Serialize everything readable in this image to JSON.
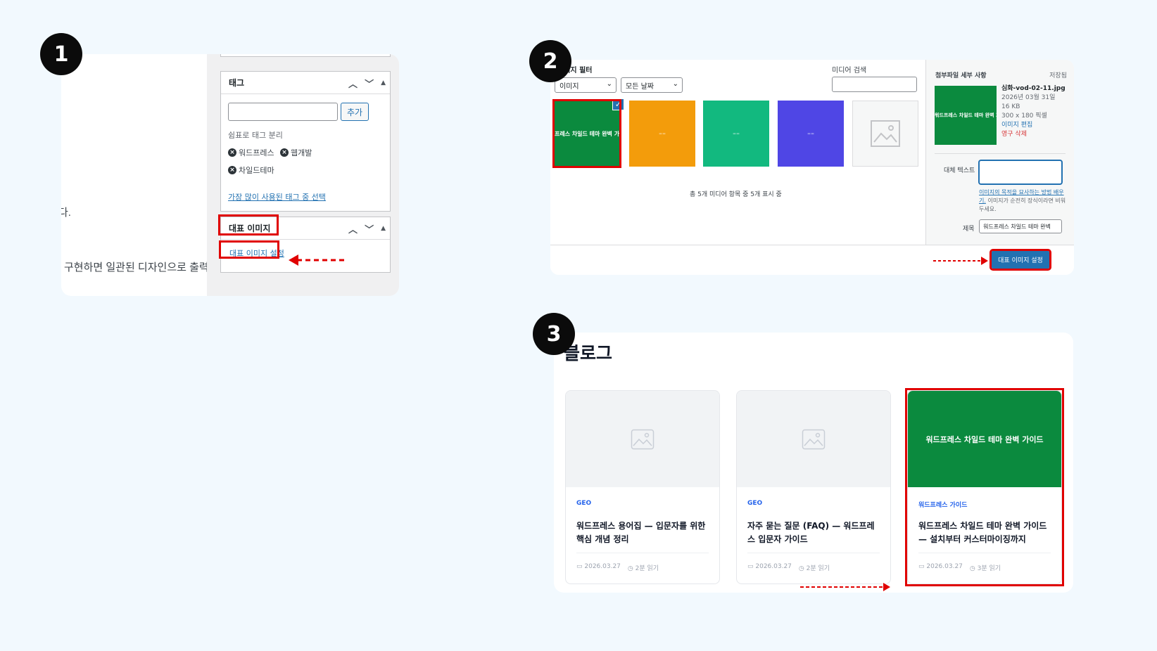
{
  "steps": [
    "1",
    "2",
    "3"
  ],
  "panel1": {
    "left_fragment_1": "다.",
    "left_fragment_2": "구현하면 일관된 디자인으로 출력",
    "tags_box": {
      "title": "태그",
      "add_button": "추가",
      "hint": "쉼표로 태그 분리",
      "tags": [
        "워드프레스",
        "웹개발",
        "차일드테마"
      ],
      "popular_link": "가장 많이 사용된 태그 중 선택"
    },
    "featured_box": {
      "title": "대표 이미지",
      "set_link": "대표 이미지 설정"
    }
  },
  "panel2": {
    "filter_label": "이미지 필터",
    "type_select": "이미지",
    "date_select": "모든 날짜",
    "search_label": "미디어 검색",
    "thumbnails": [
      {
        "label": "워드프레스 차일드 테마 완벽 가이드",
        "color": "#0b8a3e",
        "selected": true
      },
      {
        "label": "",
        "color": "#f39c0b"
      },
      {
        "label": "",
        "color": "#12b97f"
      },
      {
        "label": "",
        "color": "#4f46e5"
      },
      {
        "label": "",
        "color": "#f6f7f7"
      }
    ],
    "count_text": "총 5개 미디어 항목 중 5개 표시 중",
    "details": {
      "heading": "첨부파일 세부 사항",
      "saved": "저장됨",
      "thumb_label": "워드프레스 차일드 테마 완벽 가이드",
      "filename": "심화-vod-02-11.jpg",
      "date": "2026년 03월 31일",
      "size": "16 KB",
      "dimensions": "300 x 180 픽셀",
      "edit_link": "이미지 편집",
      "delete_link": "영구 삭제",
      "alt_label": "대체 텍스트",
      "alt_help_link": "이미지의 목적을 묘사하는 방법 배우기.",
      "alt_help_text": "이미지가 순전히 장식이라면 비워두세요.",
      "title_label": "제목",
      "title_value": "워드프레스 차일드 테마 완벽"
    },
    "set_button": "대표 이미지 설정"
  },
  "panel3": {
    "heading": "블로그",
    "cards": [
      {
        "category": "GEO",
        "title": "워드프레스 용어집 — 입문자를 위한 핵심 개념 정리",
        "date": "2026.03.27",
        "read": "2분 읽기",
        "image_text": ""
      },
      {
        "category": "GEO",
        "title": "자주 묻는 질문 (FAQ) — 워드프레스 입문자 가이드",
        "date": "2026.03.27",
        "read": "2분 읽기",
        "image_text": ""
      },
      {
        "category": "워드프레스 가이드",
        "title": "워드프레스 차일드 테마 완벽 가이드 — 설치부터 커스터마이징까지",
        "date": "2026.03.27",
        "read": "3분 읽기",
        "image_text": "워드프레스 차일드 테마 완벽 가이드"
      }
    ]
  },
  "colors": {
    "background": "#f2f9fe",
    "highlight": "#e00000",
    "wp_blue": "#2271b1",
    "featured_green": "#0b8a3e"
  }
}
